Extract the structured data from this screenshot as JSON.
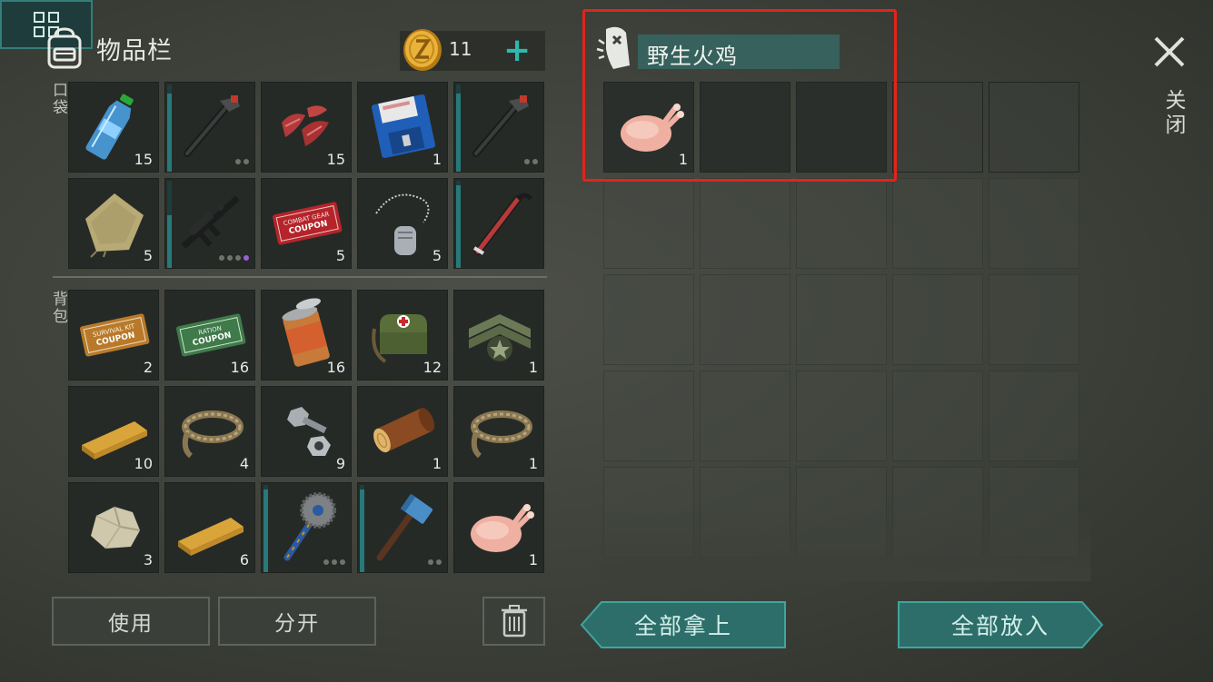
{
  "inventory": {
    "title": "物品栏",
    "coins": "11",
    "plus": "+",
    "pocket_label": "口袋",
    "bag_label": "背包",
    "pocket_slots": [
      {
        "item": "water-bottle",
        "qty": "15"
      },
      {
        "item": "pipe-wrench",
        "qty": "",
        "durability": 0.9,
        "dots": 2
      },
      {
        "item": "raw-meat",
        "qty": "15"
      },
      {
        "item": "floppy-disk",
        "qty": "1"
      },
      {
        "item": "pipe-wrench",
        "qty": "",
        "durability": 0.9,
        "dots": 2
      },
      {
        "item": "cloth-rag",
        "qty": "5"
      },
      {
        "item": "assault-rifle",
        "qty": "",
        "durability": 0.6,
        "dots": 4,
        "purple_dot": true
      },
      {
        "item": "combat-gear-coupon",
        "qty": "5",
        "text_top": "COMBAT GEAR",
        "text_bottom": "COUPON"
      },
      {
        "item": "dog-tag",
        "qty": "5"
      },
      {
        "item": "crowbar",
        "qty": "",
        "durability": 0.95
      }
    ],
    "bag_slots": [
      {
        "item": "survival-kit-coupon",
        "qty": "2",
        "text_top": "SURVIVAL KIT",
        "text_bottom": "COUPON"
      },
      {
        "item": "ration-coupon",
        "qty": "16",
        "text_top": "RATION",
        "text_bottom": "COUPON"
      },
      {
        "item": "canned-food",
        "qty": "16"
      },
      {
        "item": "medkit-bag",
        "qty": "12"
      },
      {
        "item": "rank-chevron",
        "qty": "1"
      },
      {
        "item": "wooden-plank",
        "qty": "10"
      },
      {
        "item": "rope",
        "qty": "4"
      },
      {
        "item": "nuts-bolts",
        "qty": "9"
      },
      {
        "item": "log",
        "qty": "1"
      },
      {
        "item": "rope",
        "qty": "1"
      },
      {
        "item": "stone",
        "qty": "3"
      },
      {
        "item": "wooden-plank",
        "qty": "6"
      },
      {
        "item": "saw-blade-mace",
        "qty": "",
        "durability": 0.95,
        "dots": 3
      },
      {
        "item": "sledgehammer",
        "qty": "",
        "durability": 0.95,
        "dots": 2
      },
      {
        "item": "raw-turkey",
        "qty": "1"
      }
    ],
    "buttons": {
      "use": "使用",
      "split": "分开",
      "trash": "trash-icon"
    }
  },
  "loot": {
    "name": "野生火鸡",
    "slots": [
      {
        "item": "raw-turkey",
        "qty": "1"
      }
    ]
  },
  "close": {
    "label": "关闭"
  },
  "actions": {
    "take_all": "全部拿上",
    "put_all": "全部放入",
    "sort": "sort-grid-icon"
  },
  "colors": {
    "accent": "#2fb9ae",
    "highlight_box": "#e3231c",
    "loot_name_bg": "#36615d"
  }
}
